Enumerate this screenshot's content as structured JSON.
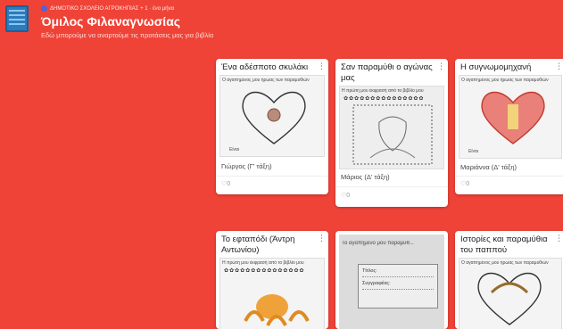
{
  "header": {
    "meta_line": "ΔΗΜΟΤΙΚΟ ΣΧΟΛΕΙΟ ΑΓΡΟΚΗΠΙΑΣ + 1 · ένα μήνα",
    "title": "Όμιλος Φιλαναγνωσίας",
    "subtitle": "Εδώ μπορούμε να αναρτούμε τις προτάσεις μας για βιβλία"
  },
  "cards": [
    {
      "title": "Ένα αδέσποτο σκυλάκι",
      "thumb_header": "Ο αγαπημένος μου ήρωας των παραμυθιών",
      "author": "Γιώργος (Γ' τάξη)",
      "likes": "0",
      "thumb_footer": "Είναι"
    },
    {
      "title": "Σαν παραμύθι ο αγώνας μας",
      "thumb_header": "Η πρώτη μου έκφρασή από το βιβλίο μου",
      "author": "Μάριος (Δ' τάξη)",
      "likes": "0"
    },
    {
      "title": "Η συγνωμομηχανή",
      "thumb_header": "Ο αγαπημένος μου ήρωας των παραμυθιών",
      "author": "Μαριάννα (Δ' τάξη)",
      "likes": "0",
      "thumb_footer": "Είναι"
    },
    {
      "title": "Το εφταπόδι (Άντρη Αντωνίου)",
      "thumb_header": "Η πρώτη μου έκφρασή από το βιβλίο μου"
    },
    {
      "title": "",
      "thumb_header": "Το αγαπημένο μου παραμύθ...",
      "thumb_lines": [
        "Τίτλος:",
        "Συγγραφέας:"
      ]
    },
    {
      "title": "Ιστορίες και παραμύθια του παππού",
      "thumb_header": "Ο αγαπημένος μου ήρωας των παραμυθιών"
    }
  ],
  "icons": {
    "more": "kebab-icon",
    "like": "heart-outline-icon"
  }
}
